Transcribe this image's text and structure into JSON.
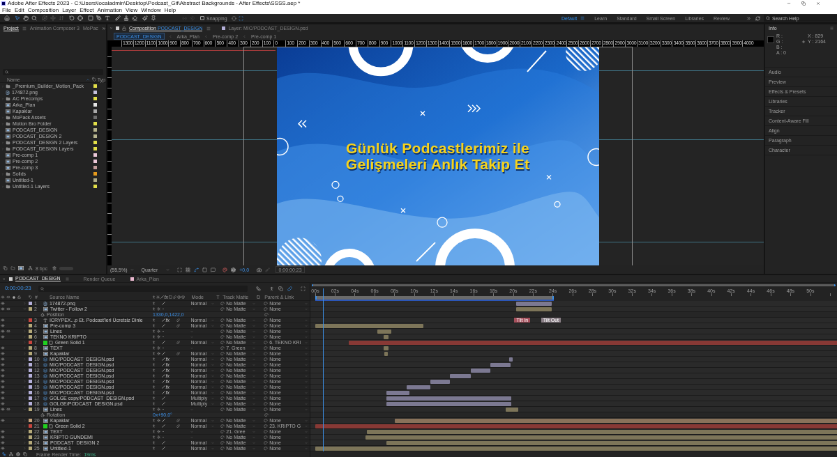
{
  "window": {
    "title": "Adobe After Effects 2023 - C:\\Users\\localadmin\\Desktop\\Podcast_Gif\\Abstract Backgrounds - After Effects\\SSSS.aep *"
  },
  "menu": [
    "File",
    "Edit",
    "Composition",
    "Layer",
    "Effect",
    "Animation",
    "View",
    "Window",
    "Help"
  ],
  "toolbar": {
    "snapping": {
      "label": "Snapping",
      "checked": false
    },
    "workspaces": [
      {
        "label": "Default",
        "selected": true
      },
      {
        "label": "Learn",
        "selected": false
      },
      {
        "label": "Standard",
        "selected": false
      },
      {
        "label": "Small Screen",
        "selected": false
      },
      {
        "label": "Libraries",
        "selected": false
      },
      {
        "label": "Review",
        "selected": false
      }
    ],
    "search": {
      "placeholder": "Search Help"
    }
  },
  "project": {
    "tabs": [
      {
        "label": "Project",
        "selected": true
      },
      {
        "label": "Animation Composer 3",
        "selected": false
      },
      {
        "label": "MoPac",
        "selected": false
      }
    ],
    "columns": {
      "name": "Name",
      "type": "Typ"
    },
    "items": [
      {
        "name": "_Premium_Builder_Motion_Pack",
        "kind": "folder",
        "color": "#e2df48"
      },
      {
        "name": "174872.png",
        "kind": "image",
        "color": "#c3c0dc"
      },
      {
        "name": "AC Precomps",
        "kind": "folder",
        "color": "#e2df48"
      },
      {
        "name": "Arka_Plan",
        "kind": "comp",
        "color": "#e6e6e6"
      },
      {
        "name": "Kapaklar",
        "kind": "comp",
        "color": "#a9a9a9"
      },
      {
        "name": "MoPack Assets",
        "kind": "folder",
        "color": "#6e6e6e"
      },
      {
        "name": "Motion Bro Folder",
        "kind": "folder",
        "color": "#e2df48"
      },
      {
        "name": "PODCAST_DESIGN",
        "kind": "comp",
        "color": "#b7b48e"
      },
      {
        "name": "PODCAST_DESIGN 2",
        "kind": "comp",
        "color": "#b7b48e"
      },
      {
        "name": "PODCAST_DESIGN 2 Layers",
        "kind": "folder",
        "color": "#e2df48"
      },
      {
        "name": "PODCAST_DESIGN Layers",
        "kind": "folder",
        "color": "#e2df48"
      },
      {
        "name": "Pre-comp 1",
        "kind": "comp",
        "color": "#ecc9d9"
      },
      {
        "name": "Pre-comp 2",
        "kind": "comp",
        "color": "#ecc9d9"
      },
      {
        "name": "Pre-comp 3",
        "kind": "comp",
        "color": "#c49c9c"
      },
      {
        "name": "Solids",
        "kind": "folder",
        "color": "#e59a1c"
      },
      {
        "name": "Untitled-1",
        "kind": "comp",
        "color": "#b0ae8a"
      },
      {
        "name": "Untitled-1 Layers",
        "kind": "folder",
        "color": "#e2df48"
      }
    ],
    "bit_depth": "8 bpc"
  },
  "composition": {
    "tabs": [
      {
        "label": "Composition",
        "name": "PODCAST_DESIGN",
        "selected": true
      },
      {
        "label": "Layer:",
        "name": "MIC/PODCAST_DESIGN.psd",
        "selected": false
      }
    ],
    "breadcrumbs": [
      {
        "label": "PODCAST_DESIGN",
        "selected": true
      },
      {
        "label": "Arka_Plan",
        "selected": false
      },
      {
        "label": "Pre-comp 2",
        "selected": false
      },
      {
        "label": "Pre-comp 1",
        "selected": false
      }
    ],
    "ruler": [
      "1300",
      "1200",
      "1100",
      "1000",
      "900",
      "800",
      "700",
      "600",
      "500",
      "400",
      "300",
      "200",
      "100",
      "0",
      "100",
      "200",
      "300",
      "400",
      "500",
      "600",
      "700",
      "800",
      "900",
      "1000",
      "1100",
      "1200",
      "1300",
      "1400",
      "1500",
      "1600",
      "1700",
      "1800",
      "1900",
      "2000",
      "2100",
      "2200",
      "2300",
      "2400",
      "2500",
      "2600",
      "2700",
      "2800",
      "2900",
      "3000",
      "3100",
      "3200",
      "3300",
      "3400",
      "3500",
      "3600",
      "3700",
      "3800",
      "3900",
      "4000"
    ],
    "headline": [
      "Günlük Podcastlerimiz ile",
      "Gelişmeleri Anlık Takip Et"
    ],
    "magnification": "(55,5%)",
    "resolution": "Quarter",
    "exposure": "+0,0",
    "timecode": "0:00:00:23"
  },
  "info": {
    "title": "Info",
    "channels": [
      "R :",
      "G :",
      "B :",
      "A : 0"
    ],
    "coordinates": [
      "X : 829",
      "Y : 2164"
    ]
  },
  "panels": [
    "Audio",
    "Preview",
    "Effects & Presets",
    "Libraries",
    "Tracker",
    "Content-Aware Fill",
    "Align",
    "Paragraph",
    "Character"
  ],
  "timeline": {
    "tabs": [
      {
        "label": "PODCAST_DESIGN",
        "selected": true,
        "color": "#cfcfcf"
      },
      {
        "label": "Render Queue",
        "selected": false
      },
      {
        "label": "Arka_Plan",
        "selected": false,
        "color": "#eab8d0"
      }
    ],
    "timecode": "0:00:00:23",
    "columns": {
      "number": "#",
      "source_name": "Source Name",
      "fx": "fx",
      "mode": "Mode",
      "t": "T",
      "track_matte": "Track Matte",
      "parent": "Parent & Link"
    },
    "ruler": [
      "00s",
      "02s",
      "04s",
      "06s",
      "08s",
      "10s",
      "12s",
      "14s",
      "16s",
      "18s",
      "20s",
      "22s",
      "24s",
      "26s",
      "28s",
      "30s",
      "32s",
      "34s",
      "36s",
      "38s",
      "40s",
      "42s",
      "44s",
      "46s",
      "48s",
      "50s"
    ],
    "playhead": {
      "level": 0.015
    },
    "layers": [
      {
        "number": "1",
        "name": "174872.png",
        "kind": "image",
        "color": "#b4afd9",
        "visible": true,
        "audio": false,
        "expanded": false,
        "mode": "Normal",
        "track_matte": "No Matte",
        "parent": "None"
      },
      {
        "number": "2",
        "name": "Twitter - Follow 2",
        "kind": "comp",
        "color": "#b5a979",
        "visible": true,
        "audio": true,
        "expanded": true,
        "collapse": true,
        "track_matte": "No Matte",
        "parent": "None",
        "property": {
          "name": "Position",
          "value": "1330,0,1422,0"
        }
      },
      {
        "number": "3",
        "name": "ICRYPEX...p Et. Podcast'leri Ücretsiz Dinle",
        "kind": "text",
        "color": "#c8453e",
        "visible": true,
        "audio": false,
        "expanded": false,
        "effect_switch": {
          "label": "fx",
          "on": true
        },
        "motion_blur": true,
        "mode": "Normal",
        "track_matte": "No Matte",
        "parent": "None",
        "markers": [
          "Tilt In",
          "Tilt Out"
        ]
      },
      {
        "number": "4",
        "name": "Pre-comp 3",
        "kind": "comp",
        "color": "#b5a979",
        "visible": true,
        "audio": false,
        "expanded": false,
        "motion_blur": true,
        "mode": "Normal",
        "track_matte": "No Matte",
        "parent": "None"
      },
      {
        "number": "5",
        "name": "Lines",
        "kind": "comp",
        "color": "#b5a979",
        "visible": true,
        "audio": true,
        "expanded": false,
        "collapse": true,
        "track_matte": "No Matte",
        "parent": "None"
      },
      {
        "number": "6",
        "name": "TEKNO KRIPTO",
        "kind": "comp",
        "color": "#b5a979",
        "visible": true,
        "audio": false,
        "expanded": false,
        "collapse": true,
        "track_matte": "No Matte",
        "parent": "None"
      },
      {
        "number": "7",
        "name": "Green Solid 1",
        "kind": "solid",
        "color": "#c8453e",
        "visible": false,
        "audio": false,
        "expanded": false,
        "motion_blur": true,
        "mode": "Normal",
        "track_matte": "No Matte",
        "parent": "6. TEKNO KRI"
      },
      {
        "number": "8",
        "name": "TEXT",
        "kind": "comp",
        "color": "#b5a979",
        "visible": true,
        "audio": false,
        "expanded": false,
        "collapse": true,
        "track_matte": "7. Green",
        "parent": "None"
      },
      {
        "number": "9",
        "name": "Kapaklar",
        "kind": "comp",
        "color": "#b5a979",
        "visible": true,
        "audio": false,
        "expanded": false,
        "collapse": true,
        "motion_blur": true,
        "mode": "Normal",
        "track_matte": "No Matte",
        "parent": "None"
      },
      {
        "number": "10",
        "name": "MIC/PODCAST_DESIGN.psd",
        "kind": "psd",
        "color": "#b4afd9",
        "visible": true,
        "audio": false,
        "expanded": false,
        "effect_switch": {
          "label": "fx",
          "on": true
        },
        "mode": "Normal",
        "track_matte": "No Matte",
        "parent": "None"
      },
      {
        "number": "11",
        "name": "MIC/PODCAST_DESIGN.psd",
        "kind": "psd",
        "color": "#b4afd9",
        "visible": true,
        "audio": false,
        "expanded": false,
        "effect_switch": {
          "label": "fx",
          "on": true
        },
        "mode": "Normal",
        "track_matte": "No Matte",
        "parent": "None"
      },
      {
        "number": "12",
        "name": "MIC/PODCAST_DESIGN.psd",
        "kind": "psd",
        "color": "#b4afd9",
        "visible": true,
        "audio": false,
        "expanded": false,
        "effect_switch": {
          "label": "fx",
          "on": true
        },
        "mode": "Normal",
        "track_matte": "No Matte",
        "parent": "None"
      },
      {
        "number": "13",
        "name": "MIC/PODCAST_DESIGN.psd",
        "kind": "psd",
        "color": "#b4afd9",
        "visible": true,
        "audio": false,
        "expanded": false,
        "effect_switch": {
          "label": "fx",
          "on": true
        },
        "mode": "Normal",
        "track_matte": "No Matte",
        "parent": "None"
      },
      {
        "number": "14",
        "name": "MIC/PODCAST_DESIGN.psd",
        "kind": "psd",
        "color": "#b4afd9",
        "visible": true,
        "audio": false,
        "expanded": false,
        "effect_switch": {
          "label": "fx",
          "on": true
        },
        "mode": "Normal",
        "track_matte": "No Matte",
        "parent": "None"
      },
      {
        "number": "15",
        "name": "MIC/PODCAST_DESIGN.psd",
        "kind": "psd",
        "color": "#b4afd9",
        "visible": true,
        "audio": false,
        "expanded": false,
        "effect_switch": {
          "label": "fx",
          "on": true
        },
        "mode": "Normal",
        "track_matte": "No Matte",
        "parent": "None"
      },
      {
        "number": "16",
        "name": "MIC/PODCAST_DESIGN.psd",
        "kind": "psd",
        "color": "#b4afd9",
        "visible": true,
        "audio": false,
        "expanded": false,
        "effect_switch": {
          "label": "fx",
          "on": true
        },
        "mode": "Normal",
        "track_matte": "No Matte",
        "parent": "None"
      },
      {
        "number": "17",
        "name": "GOLGE copy/PODCAST_DESIGN.psd",
        "kind": "psd",
        "color": "#b4afd9",
        "visible": true,
        "audio": false,
        "expanded": false,
        "mode": "Multiply",
        "track_matte": "No Matte",
        "parent": "None"
      },
      {
        "number": "18",
        "name": "GOLGE/PODCAST_DESIGN.psd",
        "kind": "psd",
        "color": "#b4afd9",
        "visible": true,
        "audio": false,
        "expanded": false,
        "mode": "Multiply",
        "track_matte": "No Matte",
        "parent": "None"
      },
      {
        "number": "19",
        "name": "Lines",
        "kind": "comp",
        "color": "#b5a979",
        "visible": true,
        "audio": true,
        "expanded": true,
        "collapse": true,
        "track_matte": "No Matte",
        "parent": "None",
        "property": {
          "name": "Rotation",
          "value": "0x+90,0°"
        }
      },
      {
        "number": "20",
        "name": "Kapaklar",
        "kind": "comp",
        "color": "#c9a47c",
        "visible": true,
        "audio": false,
        "expanded": false,
        "collapse": true,
        "motion_blur": true,
        "mode": "Normal",
        "track_matte": "No Matte",
        "parent": "None"
      },
      {
        "number": "21",
        "name": "Green Solid 2",
        "kind": "solid",
        "color": "#c8453e",
        "visible": false,
        "audio": false,
        "expanded": false,
        "motion_blur": true,
        "mode": "Normal",
        "track_matte": "No Matte",
        "parent": "23. KRIPTO G"
      },
      {
        "number": "22",
        "name": "TEXT",
        "kind": "comp",
        "color": "#b5a979",
        "visible": true,
        "audio": false,
        "expanded": false,
        "collapse": true,
        "track_matte": "21. Gree",
        "parent": "None"
      },
      {
        "number": "23",
        "name": "KRIPTO GUNDEMI",
        "kind": "comp",
        "color": "#b5a979",
        "visible": true,
        "audio": false,
        "expanded": false,
        "collapse": true,
        "track_matte": "No Matte",
        "parent": "None"
      },
      {
        "number": "24",
        "name": "PODCAST_DESIGN 2",
        "kind": "comp",
        "color": "#b5a979",
        "visible": true,
        "audio": false,
        "expanded": false,
        "mode": "Normal",
        "track_matte": "No Matte",
        "parent": "None"
      },
      {
        "number": "25",
        "name": "Untitled-1",
        "kind": "comp",
        "color": "#b5a979",
        "visible": true,
        "audio": false,
        "expanded": false,
        "mode": "Normal",
        "track_matte": "No Matte",
        "parent": "None"
      }
    ],
    "frame_render": {
      "label": "Frame Render Time:",
      "value": "19ms"
    }
  }
}
